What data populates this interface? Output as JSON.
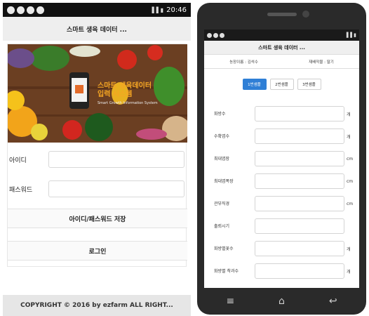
{
  "left": {
    "status": {
      "time": "20:46"
    },
    "title": "스마트 생육 데이터 ...",
    "banner": {
      "line1": "스마트 생육데이터",
      "line2": "입력 시스템",
      "sub": "Smart Growth Information System"
    },
    "id_label": "아이디",
    "pw_label": "패스워드",
    "save_button": "아이디/패스워드 저장",
    "login_button": "로그인",
    "footer": "COPYRIGHT © 2016 by ezfarm ALL RIGHT..."
  },
  "phone": {
    "title": "스마트 생육 데이터 ...",
    "info_left": "농장이름 : 김석수",
    "info_right": "재배작물 : 딸기",
    "tabs": [
      "1번샘플",
      "2번샘플",
      "3번샘플"
    ],
    "fields": [
      {
        "label": "화방수",
        "unit": "개"
      },
      {
        "label": "수확엽수",
        "unit": "개"
      },
      {
        "label": "최대엽장",
        "unit": "cm"
      },
      {
        "label": "최대엽폭장",
        "unit": "cm"
      },
      {
        "label": "관부직경",
        "unit": "cm"
      },
      {
        "label": "출뢰시기",
        "unit": ""
      },
      {
        "label": "화방별꽃수",
        "unit": "개"
      },
      {
        "label": "화방별 착과수",
        "unit": "개"
      }
    ]
  },
  "colors": {
    "accent": "#2f7fd6",
    "banner_text": "#f5a623"
  }
}
